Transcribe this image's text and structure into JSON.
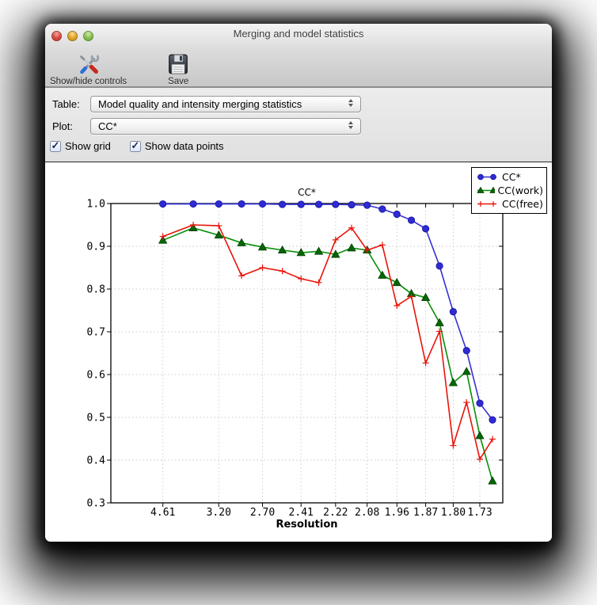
{
  "window": {
    "title": "Merging and model statistics"
  },
  "toolbar": {
    "buttons": [
      {
        "label": "Show/hide controls",
        "icon": "tools-icon"
      },
      {
        "label": "Save",
        "icon": "floppy-icon"
      }
    ]
  },
  "controls": {
    "table_label": "Table:",
    "table_value": "Model quality and intensity merging statistics",
    "plot_label": "Plot:",
    "plot_value": "CC*",
    "checkboxes": [
      {
        "label": "Show grid",
        "checked": true,
        "check_glyph": "✓"
      },
      {
        "label": "Show data points",
        "checked": true,
        "check_glyph": "✓"
      }
    ]
  },
  "chart_data": {
    "type": "line",
    "title": "CC*",
    "xlabel": "Resolution",
    "grid": true,
    "legend_position": "upper right",
    "x_axis_unit": "1/d^2 (reciprocal resolution squared)",
    "ylim": [
      0.3,
      1.0
    ],
    "y_ticks": [
      1.0,
      0.9,
      0.8,
      0.7,
      0.6,
      0.5,
      0.4,
      0.3
    ],
    "x_tick_labels": [
      "4.61",
      "3.20",
      "2.70",
      "2.41",
      "2.22",
      "2.08",
      "1.96",
      "1.87",
      "1.80",
      "1.73"
    ],
    "x_tick_d": [
      4.61,
      3.201,
      2.7,
      2.411,
      2.218,
      2.077,
      1.966,
      1.874,
      1.797,
      1.731
    ],
    "resolution_bins_d": [
      4.61,
      3.663,
      3.201,
      2.908,
      2.7,
      2.539,
      2.411,
      2.306,
      2.218,
      2.143,
      2.077,
      2.018,
      1.966,
      1.918,
      1.874,
      1.834,
      1.797,
      1.763,
      1.731,
      1.702
    ],
    "series": [
      {
        "name": "CC*",
        "color": "#3431d2",
        "marker_fill": "#2f2bd3",
        "marker_edge": "#16129e",
        "marker": "circle",
        "values": [
          0.999,
          0.999,
          0.999,
          0.999,
          0.999,
          0.998,
          0.998,
          0.998,
          0.998,
          0.997,
          0.996,
          0.987,
          0.975,
          0.961,
          0.941,
          0.854,
          0.747,
          0.656,
          0.533,
          0.494
        ]
      },
      {
        "name": "CC(work)",
        "color": "#078f07",
        "marker_fill": "#056605",
        "marker_edge": "#033f03",
        "marker": "triangle",
        "values": [
          0.914,
          0.943,
          0.926,
          0.908,
          0.898,
          0.891,
          0.885,
          0.888,
          0.881,
          0.896,
          0.891,
          0.832,
          0.815,
          0.789,
          0.78,
          0.721,
          0.581,
          0.607,
          0.457,
          0.351
        ]
      },
      {
        "name": "CC(free)",
        "color": "#e81309",
        "marker_fill": "#e81309",
        "marker_edge": "#e81309",
        "marker": "plus",
        "values": [
          0.923,
          0.95,
          0.948,
          0.831,
          0.85,
          0.842,
          0.824,
          0.815,
          0.915,
          0.943,
          0.891,
          0.903,
          0.761,
          0.783,
          0.627,
          0.701,
          0.434,
          0.535,
          0.402,
          0.449
        ]
      }
    ],
    "grid_color": "#c9c9c9",
    "frame_color": "#000000"
  }
}
